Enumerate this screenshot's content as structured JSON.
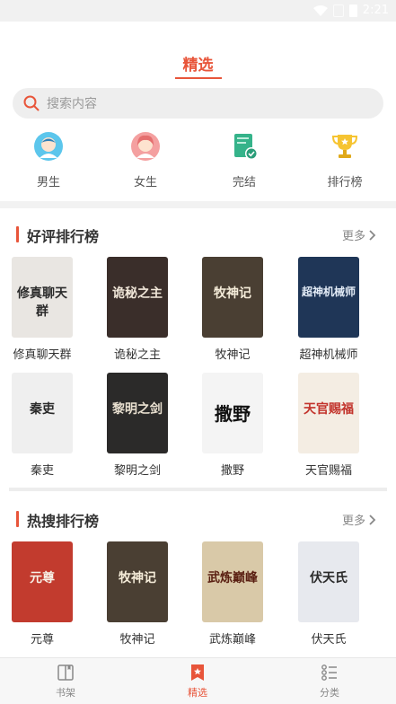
{
  "status_bar": {
    "time": "2:21"
  },
  "header": {
    "active_tab": "精选"
  },
  "search": {
    "placeholder": "搜索内容"
  },
  "categories": [
    {
      "label": "男生",
      "icon": "male-avatar-icon"
    },
    {
      "label": "女生",
      "icon": "female-avatar-icon"
    },
    {
      "label": "完结",
      "icon": "completed-book-icon"
    },
    {
      "label": "排行榜",
      "icon": "trophy-icon"
    }
  ],
  "sections": [
    {
      "title": "好评排行榜",
      "more": "更多",
      "books": [
        {
          "title": "修真聊天群",
          "cover_text": "修真聊天群",
          "cover_bg": "#e9e6e2",
          "cover_fg": "#2b2b2b"
        },
        {
          "title": "诡秘之主",
          "cover_text": "诡秘之主",
          "cover_bg": "#3a2e2a",
          "cover_fg": "#f0e6d8"
        },
        {
          "title": "牧神记",
          "cover_text": "牧神记",
          "cover_bg": "#4a3f33",
          "cover_fg": "#f5ecd9"
        },
        {
          "title": "超神机械师",
          "cover_text": "超神机械师",
          "cover_bg": "#1f3657",
          "cover_fg": "#e3ecf7"
        },
        {
          "title": "秦吏",
          "cover_text": "秦吏",
          "cover_bg": "#efefef",
          "cover_fg": "#2a2a2a"
        },
        {
          "title": "黎明之剑",
          "cover_text": "黎明之剑",
          "cover_bg": "#2b2a29",
          "cover_fg": "#e8dfcf"
        },
        {
          "title": "撒野",
          "cover_text": "撒野",
          "cover_bg": "#f4f4f4",
          "cover_fg": "#111111"
        },
        {
          "title": "天官赐福",
          "cover_text": "天官赐福",
          "cover_bg": "#f4ede3",
          "cover_fg": "#c2332b"
        }
      ]
    },
    {
      "title": "热搜排行榜",
      "more": "更多",
      "books": [
        {
          "title": "元尊",
          "cover_text": "元尊",
          "cover_bg": "#c23b2e",
          "cover_fg": "#f7efe5"
        },
        {
          "title": "牧神记",
          "cover_text": "牧神记",
          "cover_bg": "#4a3f33",
          "cover_fg": "#f5ecd9"
        },
        {
          "title": "武炼巅峰",
          "cover_text": "武炼巅峰",
          "cover_bg": "#d9c9a8",
          "cover_fg": "#5a1f12"
        },
        {
          "title": "伏天氏",
          "cover_text": "伏天氏",
          "cover_bg": "#e7e9ee",
          "cover_fg": "#2a2a2a"
        }
      ]
    }
  ],
  "bottom_nav": [
    {
      "label": "书架",
      "icon": "bookshelf-icon",
      "active": false
    },
    {
      "label": "精选",
      "icon": "featured-icon",
      "active": true
    },
    {
      "label": "分类",
      "icon": "category-list-icon",
      "active": false
    }
  ],
  "colors": {
    "accent": "#e8553a"
  }
}
